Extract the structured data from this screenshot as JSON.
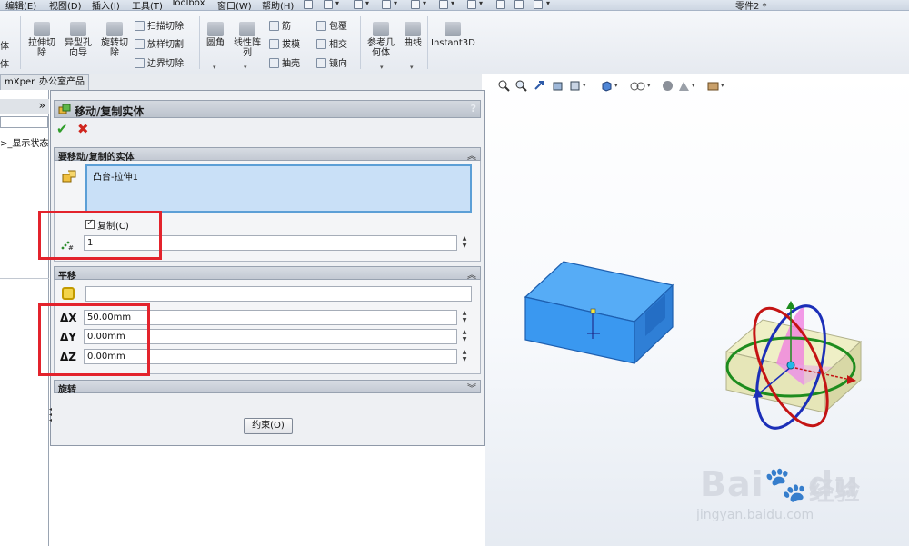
{
  "menu": {
    "items": [
      "编辑(E)",
      "视图(D)",
      "插入(I)",
      "工具(T)",
      "Toolbox",
      "窗口(W)",
      "帮助(H)"
    ],
    "doc_title": "零件2 *"
  },
  "ribbon": {
    "cut_left1": "体",
    "cut_left2": "体",
    "extrude_cut": [
      "拉伸切",
      "除"
    ],
    "hole_wizard": [
      "异型孔",
      "向导"
    ],
    "revolve_cut": [
      "旋转切",
      "除"
    ],
    "sweep_cut": "扫描切除",
    "loft_cut": "放样切割",
    "boundary_cut": "边界切除",
    "fillet": "圆角",
    "linear_pattern": [
      "线性阵",
      "列"
    ],
    "rib": "筋",
    "draft": "拔模",
    "shell": "抽壳",
    "wrap": "包覆",
    "intersect": "相交",
    "mirror": "镜向",
    "ref_geometry": [
      "参考几",
      "何体"
    ],
    "curves": "曲线",
    "instant3d": "Instant3D"
  },
  "tabs": [
    "mXpert",
    "办公室产品"
  ],
  "tree": {
    "item": ">_显示状态"
  },
  "pm": {
    "title": "移动/复制实体",
    "help": "?",
    "section_bodies": "要移动/复制的实体",
    "selected_body": "凸台-拉伸1",
    "copy_label": "复制(C)",
    "copy_checked": true,
    "copies": "1",
    "section_translate": "平移",
    "dx_label": "ΔX",
    "dx": "50.00mm",
    "dy_label": "ΔY",
    "dy": "0.00mm",
    "dz_label": "ΔZ",
    "dz": "0.00mm",
    "section_rotate": "旋转",
    "finish_button": "约束(O)"
  },
  "watermark": {
    "brand": "Bai",
    "brand2": "du",
    "cn": "经验",
    "url": "jingyan.baidu.com"
  },
  "colors": {
    "accent_box": "#3b9bf2",
    "highlight_red": "#e3232c",
    "ok_green": "#2f9d2a",
    "cancel_red": "#d0261e"
  }
}
